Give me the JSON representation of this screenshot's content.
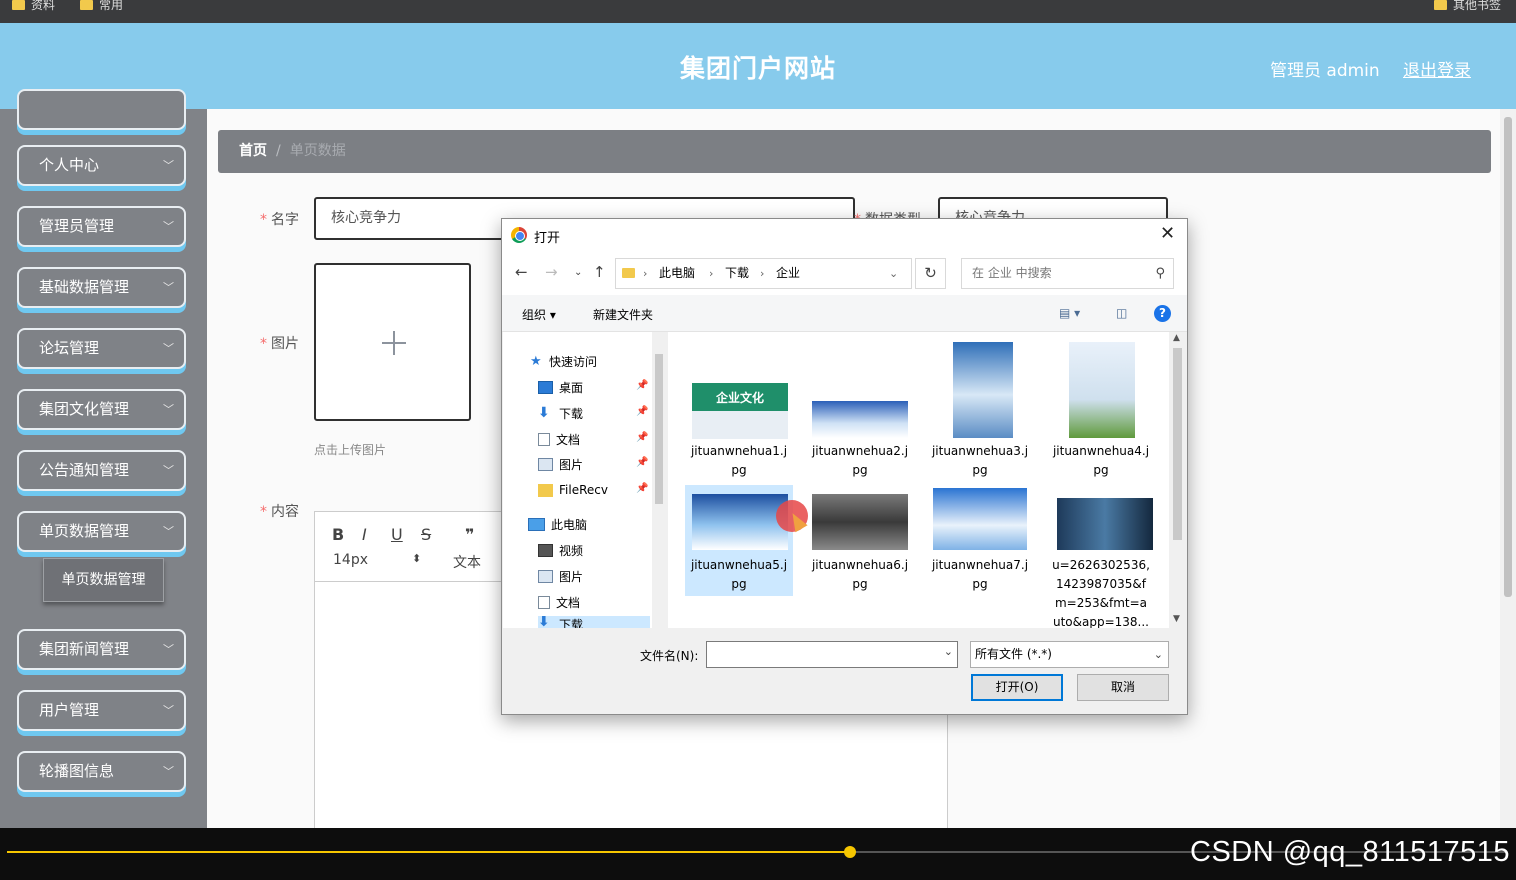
{
  "bookmarks": {
    "left_items": [
      "资料",
      "常用"
    ],
    "right_item": "其他书签"
  },
  "header": {
    "site_title": "集团门户网站",
    "admin_label": "管理员 admin",
    "logout_label": "退出登录"
  },
  "sidebar": {
    "items": [
      {
        "label": "个人中心"
      },
      {
        "label": "管理员管理"
      },
      {
        "label": "基础数据管理"
      },
      {
        "label": "论坛管理"
      },
      {
        "label": "集团文化管理"
      },
      {
        "label": "公告通知管理"
      },
      {
        "label": "单页数据管理"
      },
      {
        "label": "集团新闻管理"
      },
      {
        "label": "用户管理"
      },
      {
        "label": "轮播图信息"
      }
    ],
    "submenu_item": "单页数据管理"
  },
  "breadcrumb": {
    "home": "首页",
    "separator": "/",
    "current": "单页数据"
  },
  "form": {
    "name_label": "名字",
    "name_value": "核心竞争力",
    "type_label": "数据类型",
    "type_value": "核心竞争力",
    "image_label": "图片",
    "upload_hint": "点击上传图片",
    "content_label": "内容",
    "editor": {
      "bold": "B",
      "italic": "I",
      "underline": "U",
      "strike": "S",
      "quote": "❞",
      "font_size": "14px",
      "text_style": "文本"
    }
  },
  "dialog": {
    "title": "打开",
    "close": "✕",
    "address": [
      "此电脑",
      "下载",
      "企业"
    ],
    "search_placeholder": "在 企业 中搜索",
    "organize": "组织 ▾",
    "new_folder": "新建文件夹",
    "help": "?",
    "nav_items": [
      {
        "label": "快速访问",
        "icon": "star-icon"
      },
      {
        "label": "桌面",
        "icon": "desktop-icon"
      },
      {
        "label": "下载",
        "icon": "download-icon"
      },
      {
        "label": "文档",
        "icon": "document-icon"
      },
      {
        "label": "图片",
        "icon": "picture-icon"
      },
      {
        "label": "FileRecv",
        "icon": "folder-icon"
      },
      {
        "label": "此电脑",
        "icon": "computer-icon"
      },
      {
        "label": "视频",
        "icon": "video-icon"
      },
      {
        "label": "图片",
        "icon": "picture-icon"
      },
      {
        "label": "文档",
        "icon": "document-icon"
      },
      {
        "label": "下载",
        "icon": "download-icon"
      }
    ],
    "files": [
      {
        "line1": "jituanwnehua1.j",
        "line2": "pg",
        "thumb_text": "企业文化"
      },
      {
        "line1": "jituanwnehua2.j",
        "line2": "pg"
      },
      {
        "line1": "jituanwnehua3.j",
        "line2": "pg"
      },
      {
        "line1": "jituanwnehua4.j",
        "line2": "pg"
      },
      {
        "line1": "jituanwnehua5.j",
        "line2": "pg"
      },
      {
        "line1": "jituanwnehua6.j",
        "line2": "pg"
      },
      {
        "line1": "jituanwnehua7.j",
        "line2": "pg"
      },
      {
        "line1": "u=2626302536,",
        "line2": "1423987035&f",
        "line3": "m=253&fmt=a",
        "line4": "uto&app=138..."
      }
    ],
    "filename_label": "文件名(N):",
    "filename_value": "",
    "filetype": "所有文件 (*.*)",
    "open_button": "打开(O)",
    "cancel_button": "取消"
  },
  "player": {
    "progress": 0.562,
    "watermark": "CSDN @qq_811517515"
  },
  "colors": {
    "header": "#87cbec",
    "sidebar": "#808388",
    "accent": "#6fc8f0",
    "progress": "#f6c600"
  }
}
